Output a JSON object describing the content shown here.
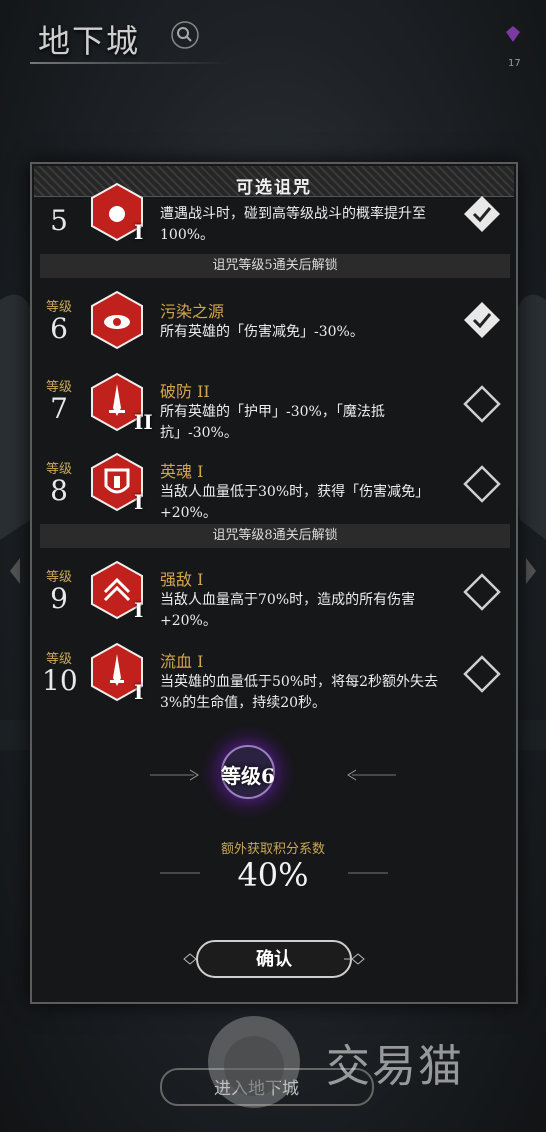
{
  "screen": {
    "title": "地下城",
    "gem_count": "17"
  },
  "panel": {
    "title": "可选诅咒",
    "level_word": "等级",
    "partial_row": {
      "level": "5",
      "roman": "I",
      "desc": "遭遇战斗时，碰到高等级战斗的概率提升至100%。",
      "checked": true
    },
    "unlock_bars": [
      "诅咒等级5通关后解锁",
      "诅咒等级8通关后解锁"
    ],
    "curses": [
      {
        "level": "6",
        "name": "污染之源",
        "roman": "",
        "desc": "所有英雄的「伤害减免」-30%。",
        "checked": true,
        "icon": "eye-icon"
      },
      {
        "level": "7",
        "name": "破防 II",
        "roman": "II",
        "desc": "所有英雄的「护甲」-30%，「魔法抵抗」-30%。",
        "checked": false,
        "icon": "sword-icon"
      },
      {
        "level": "8",
        "name": "英魂 I",
        "roman": "I",
        "desc": "当敌人血量低于30%时，获得「伤害减免」+20%。",
        "checked": false,
        "icon": "shield-icon"
      },
      {
        "level": "9",
        "name": "强敌 I",
        "roman": "I",
        "desc": "当敌人血量高于70%时，造成的所有伤害+20%。",
        "checked": false,
        "icon": "chevron-up-icon"
      },
      {
        "level": "10",
        "name": "流血 I",
        "roman": "I",
        "desc": "当英雄的血量低于50%时，将每2秒额外失去3%的生命值，持续20秒。",
        "checked": false,
        "icon": "blade-icon"
      }
    ],
    "current_level": "等级6",
    "bonus_label": "额外获取积分系数",
    "bonus_value": "40%",
    "confirm_label": "确认"
  },
  "background": {
    "enter_label": "进入地下城",
    "watermark": "交易猫"
  },
  "colors": {
    "accent_gold": "#d2a64e",
    "curse_red": "#c0211d",
    "orb_purple": "#6a2a9a"
  }
}
